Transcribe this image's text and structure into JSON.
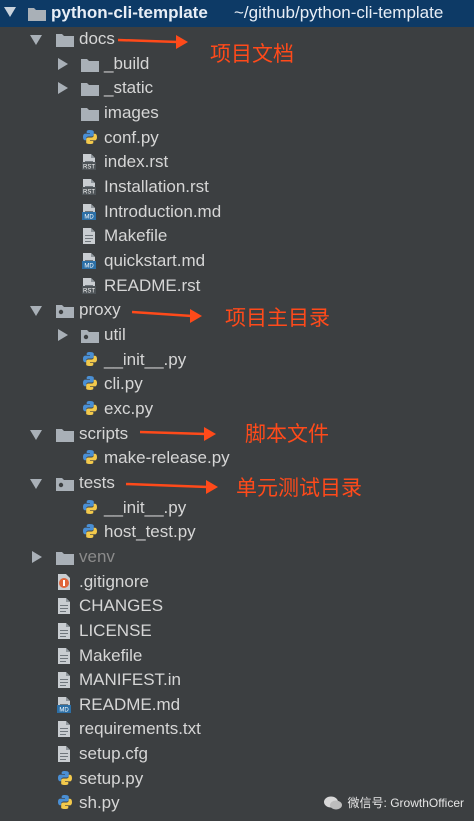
{
  "header": {
    "project_name": "python-cli-template",
    "project_path": "~/github/python-cli-template"
  },
  "tree": [
    {
      "label": "docs",
      "icon": "folder-icon",
      "expanded": true
    },
    {
      "label": "_build",
      "icon": "folder-icon",
      "expanded": false
    },
    {
      "label": "_static",
      "icon": "folder-icon",
      "expanded": false
    },
    {
      "label": "images",
      "icon": "folder-icon"
    },
    {
      "label": "conf.py",
      "icon": "python-file-icon"
    },
    {
      "label": "index.rst",
      "icon": "rst-file-icon",
      "badge": "RST"
    },
    {
      "label": "Installation.rst",
      "icon": "rst-file-icon",
      "badge": "RST"
    },
    {
      "label": "Introduction.md",
      "icon": "md-file-icon",
      "badge": "MD"
    },
    {
      "label": "Makefile",
      "icon": "text-file-icon"
    },
    {
      "label": "quickstart.md",
      "icon": "md-file-icon",
      "badge": "MD"
    },
    {
      "label": "README.rst",
      "icon": "rst-file-icon",
      "badge": "RST"
    },
    {
      "label": "proxy",
      "icon": "package-icon",
      "expanded": true
    },
    {
      "label": "util",
      "icon": "package-icon",
      "expanded": false
    },
    {
      "label": "__init__.py",
      "icon": "python-file-icon"
    },
    {
      "label": "cli.py",
      "icon": "python-file-icon"
    },
    {
      "label": "exc.py",
      "icon": "python-file-icon"
    },
    {
      "label": "scripts",
      "icon": "folder-icon",
      "expanded": true
    },
    {
      "label": "make-release.py",
      "icon": "python-file-icon"
    },
    {
      "label": "tests",
      "icon": "package-icon",
      "expanded": true
    },
    {
      "label": "__init__.py",
      "icon": "python-file-icon"
    },
    {
      "label": "host_test.py",
      "icon": "python-file-icon"
    },
    {
      "label": "venv",
      "icon": "folder-icon",
      "expanded": false
    },
    {
      "label": ".gitignore",
      "icon": "git-file-icon"
    },
    {
      "label": "CHANGES",
      "icon": "text-file-icon"
    },
    {
      "label": "LICENSE",
      "icon": "text-file-icon"
    },
    {
      "label": "Makefile",
      "icon": "text-file-icon"
    },
    {
      "label": "MANIFEST.in",
      "icon": "text-file-icon"
    },
    {
      "label": "README.md",
      "icon": "md-file-icon",
      "badge": "MD"
    },
    {
      "label": "requirements.txt",
      "icon": "text-file-icon"
    },
    {
      "label": "setup.cfg",
      "icon": "text-file-icon"
    },
    {
      "label": "setup.py",
      "icon": "python-file-icon"
    },
    {
      "label": "sh.py",
      "icon": "python-file-icon"
    }
  ],
  "annotations": {
    "docs": "项目文档",
    "proxy": "项目主目录",
    "scripts": "脚本文件",
    "tests": "单元测试目录"
  },
  "watermark": "微信号: GrowthOfficer",
  "colors": {
    "annotation": "#ff4a1a",
    "header_bg": "#0d3a66",
    "panel_bg": "#3c3f41"
  }
}
